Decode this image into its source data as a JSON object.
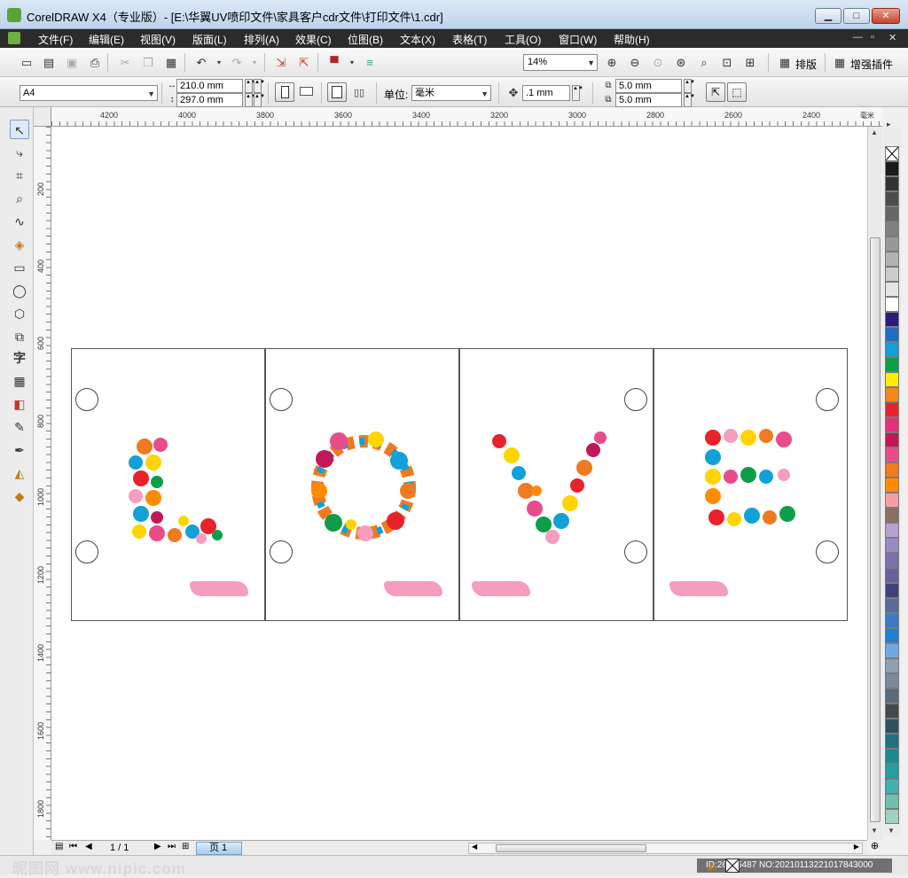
{
  "window": {
    "title": "CorelDRAW X4（专业版）- [E:\\华翼UV喷印文件\\家具客户cdr文件\\打印文件\\1.cdr]",
    "minimize_label": "▁",
    "maximize_label": "□",
    "close_label": "✕"
  },
  "menu": {
    "items": [
      "文件(F)",
      "编辑(E)",
      "视图(V)",
      "版面(L)",
      "排列(A)",
      "效果(C)",
      "位图(B)",
      "文本(X)",
      "表格(T)",
      "工具(O)",
      "窗口(W)",
      "帮助(H)"
    ],
    "mdi_controls": [
      "—",
      "▫",
      "✕"
    ]
  },
  "toolbar": {
    "zoom_value": "14%",
    "layout_label": "排版",
    "plugin_label": "增强插件"
  },
  "property_bar": {
    "paper_size": "A4",
    "width": "210.0 mm",
    "height": "297.0 mm",
    "units_label": "单位:",
    "units_value": "毫米",
    "nudge": ".1 mm",
    "dup_x": "5.0 mm",
    "dup_y": "5.0 mm"
  },
  "ruler": {
    "h_labels": [
      "4200",
      "4000",
      "3800",
      "3600",
      "3400",
      "3200",
      "3000",
      "2800",
      "2600",
      "2400"
    ],
    "h_unit": "毫米",
    "v_labels": [
      "200",
      "400",
      "600",
      "800",
      "1000",
      "1200",
      "1400",
      "1600",
      "1800"
    ]
  },
  "canvas": {
    "letters": [
      "L",
      "O",
      "V",
      "E"
    ]
  },
  "page_nav": {
    "counter": "1 / 1",
    "page_tab": "页 1"
  },
  "palette": {
    "colors": [
      "#ffffff",
      "#1a1a1a",
      "#333333",
      "#4d4d4d",
      "#666666",
      "#808080",
      "#999999",
      "#b3b3b3",
      "#cccccc",
      "#e6e6e6",
      "#ffffff",
      "#2e1a7a",
      "#1f6fc0",
      "#12a0d8",
      "#0e9e4a",
      "#ffee00",
      "#f08a1a",
      "#e8222a",
      "#e0327a",
      "#c2185b",
      "#e84c8a",
      "#f07a20",
      "#ff8c00",
      "#f4a0a0",
      "#8a7060",
      "#b8a0d0",
      "#9a8ac8",
      "#7a70b0",
      "#6a60a0",
      "#404080",
      "#5a6a9a",
      "#3a7ac0",
      "#2080d0",
      "#70a8e0",
      "#90a0b0",
      "#7a8a9a",
      "#5a6a7a",
      "#404a50",
      "#305060",
      "#207080",
      "#1a8a90",
      "#20a0a0",
      "#40b0b0",
      "#70c0b0",
      "#a0d0c0"
    ]
  },
  "status": {
    "watermark": "昵图网 www.nipic.com",
    "id_text": "ID:26915487 NO:20210113221017843000"
  }
}
